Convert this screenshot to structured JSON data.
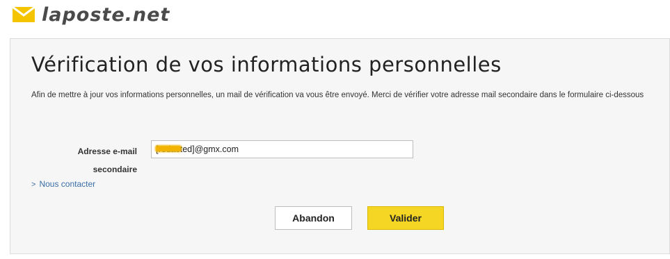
{
  "brand": {
    "name": "laposte.net",
    "accent": "#f5d624"
  },
  "page": {
    "title": "Vérification de vos informations personnelles",
    "intro": "Afin de mettre à jour vos informations personnelles, un mail de vérification va vous être envoyé. Merci de vérifier votre adresse mail secondaire dans le formulaire ci-dessous"
  },
  "form": {
    "email_label": "Adresse e-mail secondaire",
    "email_value": "[redacted]@gmx.com"
  },
  "links": {
    "contact": "Nous contacter"
  },
  "buttons": {
    "abandon": "Abandon",
    "submit": "Valider"
  }
}
